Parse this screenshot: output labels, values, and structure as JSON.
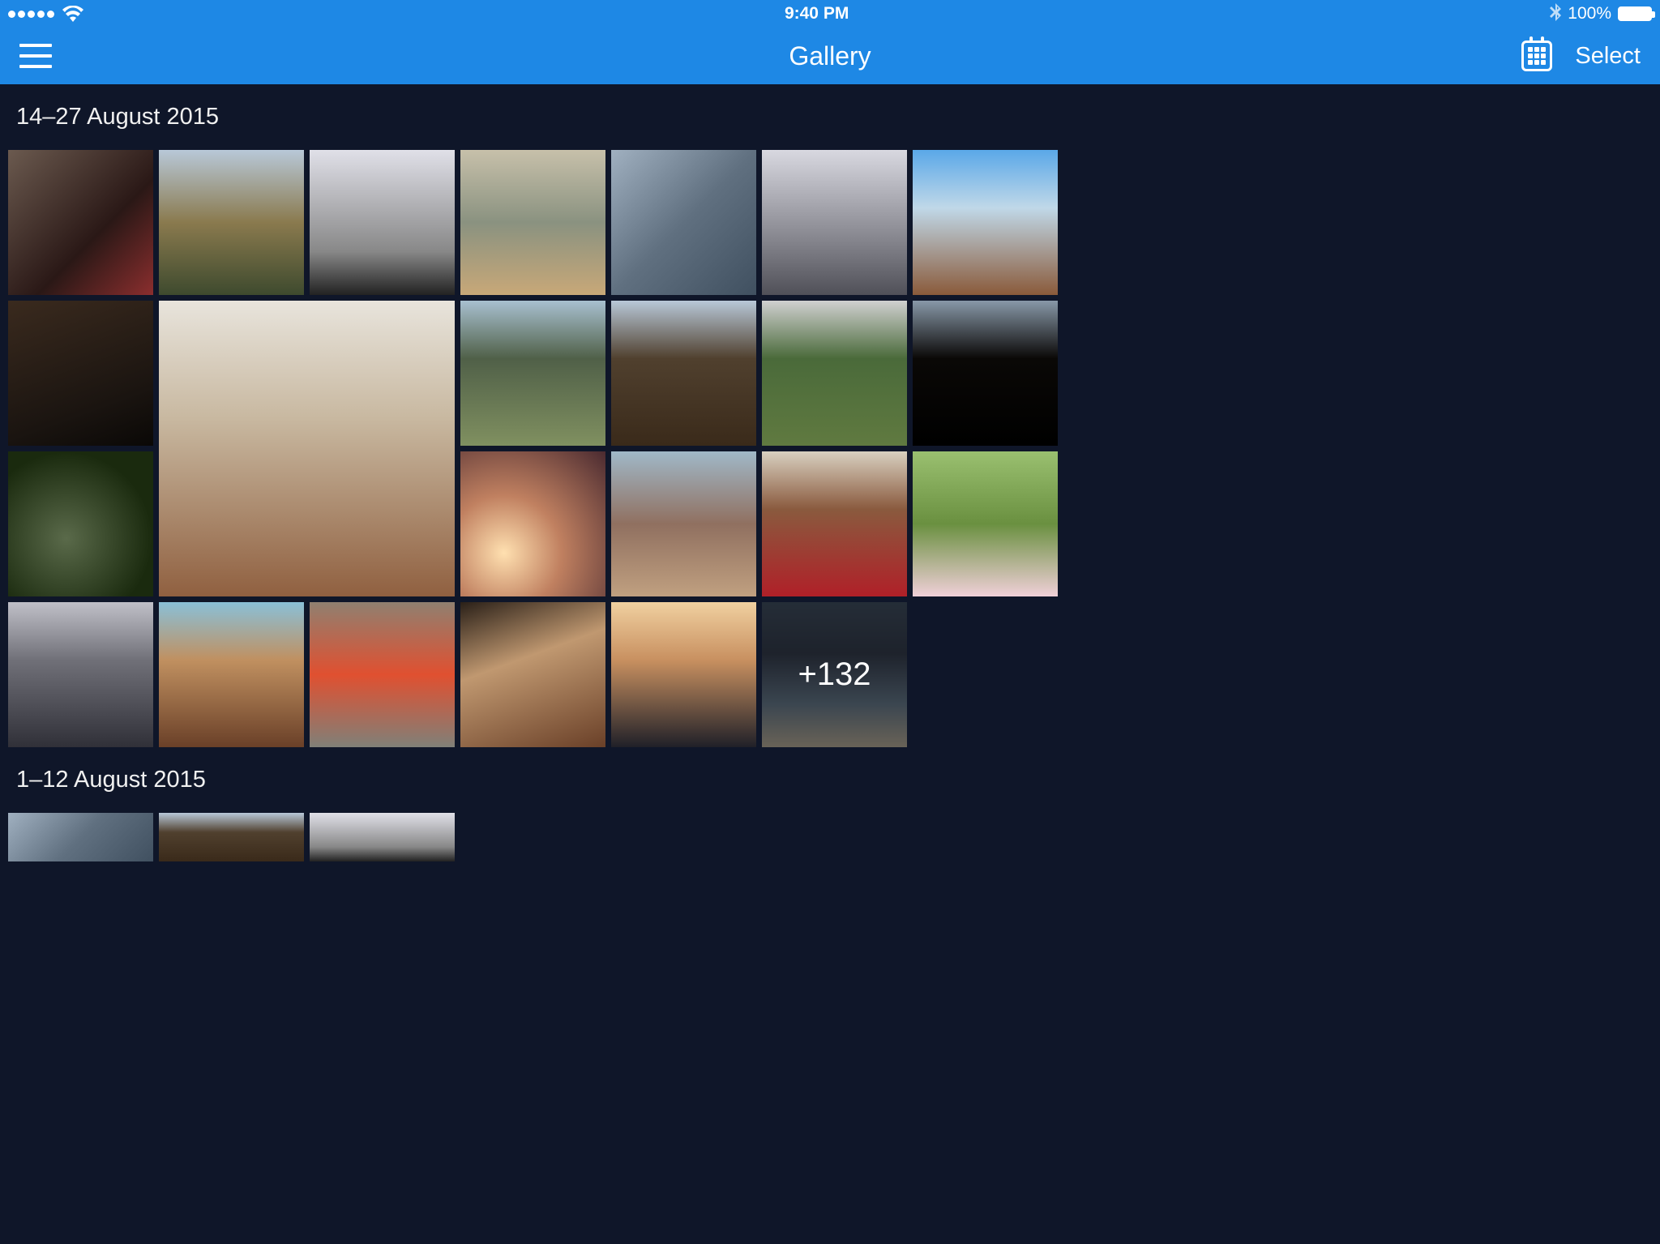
{
  "status": {
    "time": "9:40 PM",
    "battery": "100%",
    "bluetooth": "*"
  },
  "nav": {
    "title": "Gallery",
    "select": "Select"
  },
  "groups": [
    {
      "header": "14–27 August 2015",
      "more": "+132"
    },
    {
      "header": "1–12 August 2015"
    }
  ]
}
